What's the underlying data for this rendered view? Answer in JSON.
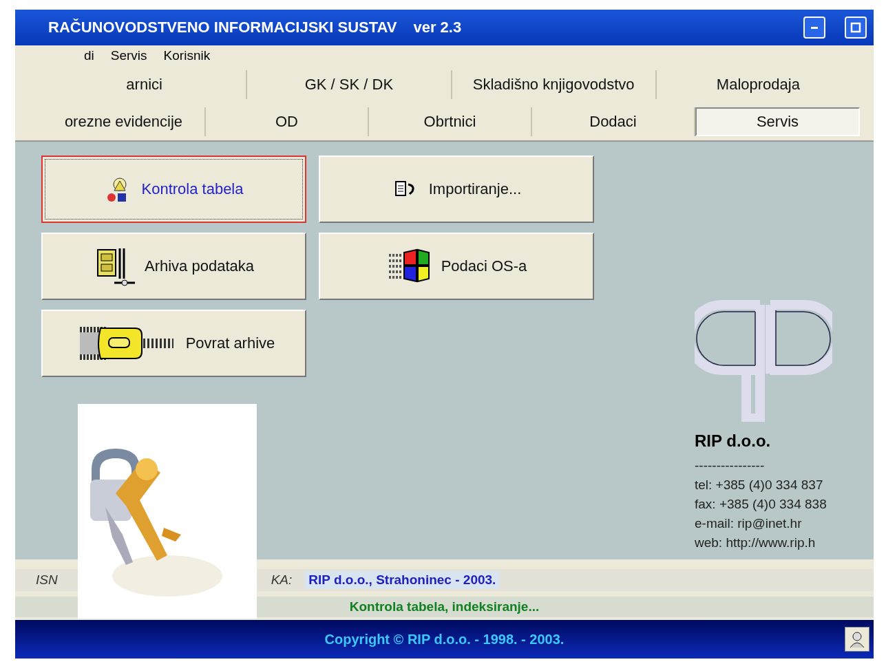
{
  "window": {
    "title": "RAČUNOVODSTVENO INFORMACIJSKI SUSTAV",
    "version": "ver 2.3"
  },
  "menu": [
    "di",
    "Servis",
    "Korisnik"
  ],
  "tab_rows": [
    [
      {
        "label": "arnici",
        "selected": false
      },
      {
        "label": "GK / SK / DK",
        "selected": false
      },
      {
        "label": "Skladišno knjigovodstvo",
        "selected": false
      },
      {
        "label": "Maloprodaja",
        "selected": false
      }
    ],
    [
      {
        "label": "orezne evidencije",
        "selected": false
      },
      {
        "label": "OD",
        "selected": false
      },
      {
        "label": "Obrtnici",
        "selected": false
      },
      {
        "label": "Dodaci",
        "selected": false
      },
      {
        "label": "Servis",
        "selected": true
      }
    ]
  ],
  "buttons": [
    {
      "label": "Kontrola tabela",
      "kind": "people",
      "focused": true
    },
    {
      "label": "Importiranje...",
      "kind": "import",
      "focused": false
    },
    {
      "label": "Arhiva podataka",
      "kind": "archive",
      "focused": false
    },
    {
      "label": "Podaci OS-a",
      "kind": "windows",
      "focused": false
    },
    {
      "label": "Povrat arhive",
      "kind": "zip",
      "focused": false
    }
  ],
  "company": {
    "name": "RIP d.o.o.",
    "separator": "----------------",
    "lines": [
      "tel: +385 (4)0 334 837",
      "fax: +385 (4)0 334 838",
      "e-mail: rip@inet.hr",
      "web: http://www.rip.h"
    ]
  },
  "status": {
    "label_start": "ISN",
    "label_end": "KA:",
    "value": "RIP d.o.o., Strahoninec - 2003.",
    "message": "Kontrola tabela, indeksiranje..."
  },
  "footer": {
    "copyright": "Copyright © RIP d.o.o. - 1998. - 2003."
  },
  "splash": {
    "kind": "picture"
  }
}
